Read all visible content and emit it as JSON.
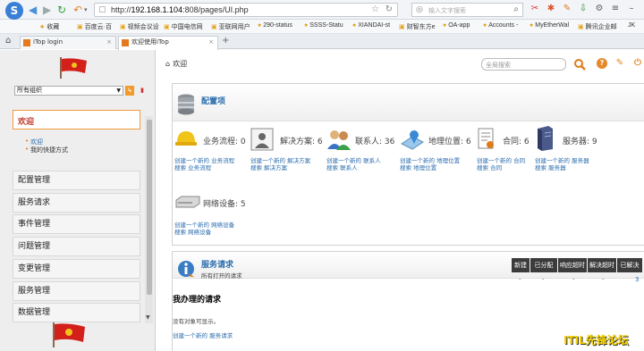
{
  "browser": {
    "url_prefix": "http://",
    "url_host": "192.168.1.104",
    "url_rest": ":808/pages/UI.php",
    "search_placeholder": "输入文字搜索",
    "bookmarks": [
      "收藏",
      "百度云·百",
      "视频会议设",
      "中国电信网",
      "亚联网用户",
      "290-status",
      "SSSS-Statu",
      "XIANDAI-st",
      "财智东方e",
      "OA-app",
      "Accounts -",
      "MyEtherWal",
      "腾讯企业邮",
      "JK"
    ],
    "tabs": [
      {
        "label": "iTop login"
      },
      {
        "label": "欢迎使用iTop"
      }
    ]
  },
  "sidebar": {
    "org_select": "所有组织",
    "welcome": "欢迎",
    "quick_links": [
      "欢迎",
      "我的快捷方式"
    ],
    "menu": [
      "配置管理",
      "服务请求",
      "事件管理",
      "问题管理",
      "变更管理",
      "服务管理",
      "数据管理"
    ]
  },
  "topbar": {
    "breadcrumb": "欢迎",
    "global_search_placeholder": "全局搜索"
  },
  "config_panel": {
    "title": "配置项",
    "items": [
      {
        "label": "业务流程: 0",
        "create": "创建一个新的 业务流程",
        "search": "搜索 业务流程",
        "icon": "helmet-icon"
      },
      {
        "label": "解决方案: 6",
        "create": "创建一个新的 解决方案",
        "search": "搜索 解决方案",
        "icon": "solution-icon"
      },
      {
        "label": "联系人: 36",
        "create": "创建一个新的 联系人",
        "search": "搜索 联系人",
        "icon": "contacts-icon"
      },
      {
        "label": "地理位置: 6",
        "create": "创建一个新的 地理位置",
        "search": "搜索 地理位置",
        "icon": "location-icon"
      },
      {
        "label": "合同: 6",
        "create": "创建一个新的 合同",
        "search": "搜索 合同",
        "icon": "contract-icon"
      },
      {
        "label": "服务器: 9",
        "create": "创建一个新的 服务器",
        "search": "搜索 服务器",
        "icon": "server-icon"
      },
      {
        "label": "网络设备: 5",
        "create": "创建一个新的 网络设备",
        "search": "搜索 网络设备",
        "icon": "network-device-icon"
      }
    ]
  },
  "service_panel": {
    "title": "服务请求",
    "subtitle": "所有打开的请求",
    "columns": [
      "新建",
      "已分配",
      "响应超时",
      "解决超时",
      "已解决"
    ],
    "values": [
      "-",
      "-",
      "-",
      "-",
      "3"
    ],
    "my_requests_title": "我办理的请求",
    "no_objects": "没有对象可显示。",
    "create_link": "创建一个新的 服务请求"
  },
  "watermark": "ITIL先锋论坛",
  "colors": {
    "link": "#2a6cae",
    "accent": "#f29a3a",
    "header_dark": "#3b3b3b"
  }
}
